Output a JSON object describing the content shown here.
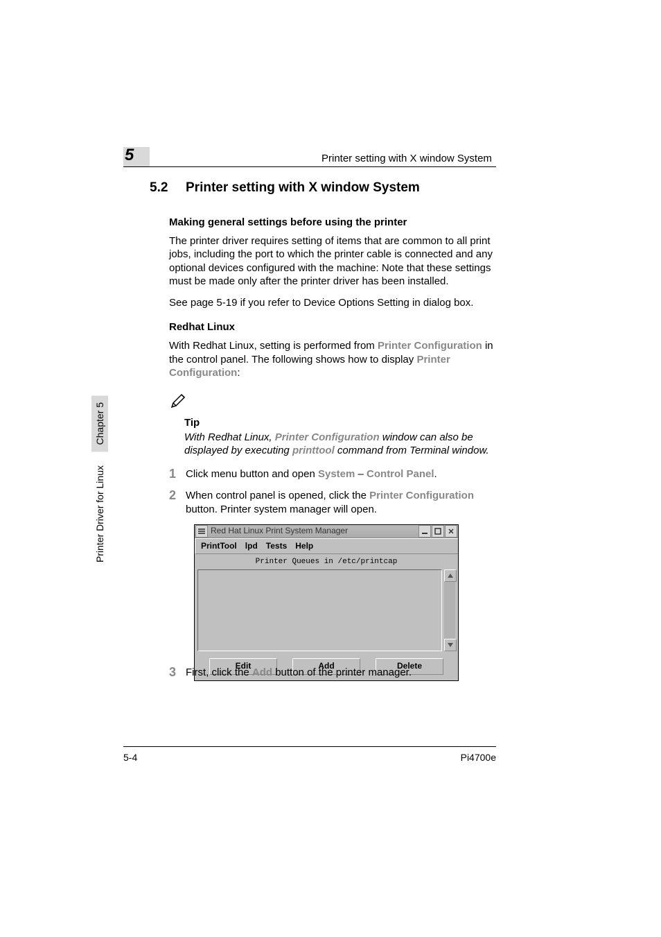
{
  "chapter_number": "5",
  "header_text": "Printer setting with X window System",
  "section_number": "5.2",
  "section_title": "Printer setting with X window System",
  "subhead1": "Making general settings before using the printer",
  "para1": "The printer driver requires setting of items that are common to all print jobs, including the port to which the printer cable is connected and any optional devices configured with the machine: Note that these settings must be made only after the printer driver has been installed.",
  "para2": "See page 5-19 if you refer to Device Options Setting in dialog box.",
  "subhead2": "Redhat Linux",
  "para3_pre": "With Redhat Linux, setting is performed from ",
  "para3_soft1": "Printer Configuration",
  "para3_mid": " in the control panel. The following shows how to display ",
  "para3_soft2": "Printer Configuration",
  "para3_end": ":",
  "tip_label": "Tip",
  "tip_pre": "With Redhat Linux, ",
  "tip_soft1": "Printer Configuration",
  "tip_mid": " window can also be displayed by executing ",
  "tip_soft2": "printtool",
  "tip_end": " command from Terminal window.",
  "step1_num": "1",
  "step1_pre": "Click menu button and open ",
  "step1_soft1": "System",
  "step1_dash": " – ",
  "step1_soft2": "Control Panel",
  "step1_end": ".",
  "step2_num": "2",
  "step2_pre": "When control panel is opened, click the ",
  "step2_soft": "Printer Configuration",
  "step2_end": " button. Printer system manager will open.",
  "step3_num": "3",
  "step3_pre": "First, click the ",
  "step3_soft": "Add",
  "step3_end": " button of the printer manager.",
  "xwin": {
    "title": "Red Hat Linux Print System Manager",
    "menu": {
      "m1": "PrintTool",
      "m2": "lpd",
      "m3": "Tests",
      "m4": "Help"
    },
    "list_label": "Printer Queues in /etc/printcap",
    "buttons": {
      "edit": "Edit",
      "add": "Add",
      "delete": "Delete"
    }
  },
  "sidebar": {
    "chapter": "Chapter 5",
    "section": "Printer Driver for Linux"
  },
  "footer": {
    "left": "5-4",
    "right": "Pi4700e"
  }
}
